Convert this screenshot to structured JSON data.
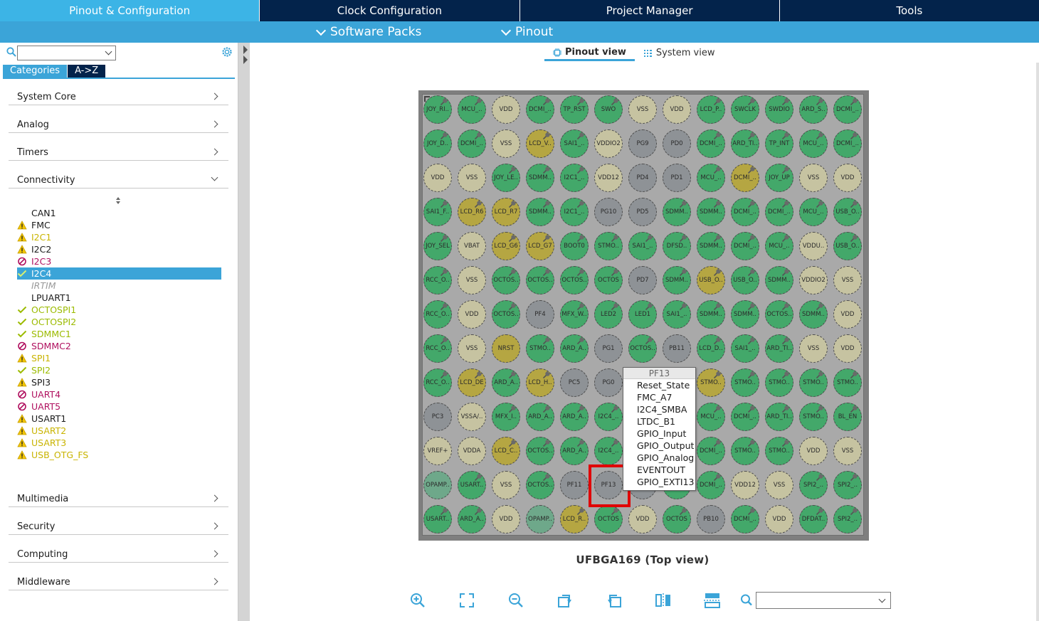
{
  "top_tabs": [
    {
      "label": "Pinout & Configuration",
      "active": true
    },
    {
      "label": "Clock Configuration",
      "active": false
    },
    {
      "label": "Project Manager",
      "active": false
    },
    {
      "label": "Tools",
      "active": false
    }
  ],
  "sub_menus": [
    "Software Packs",
    "Pinout"
  ],
  "left": {
    "search_value": "",
    "cat_tabs": [
      "Categories",
      "A->Z"
    ],
    "categories_top": [
      "System Core",
      "Analog",
      "Timers",
      "Connectivity"
    ],
    "categories_bottom": [
      "Multimedia",
      "Security",
      "Computing",
      "Middleware"
    ],
    "peripherals": [
      {
        "label": "CAN1",
        "status": "none",
        "color": "normal"
      },
      {
        "label": "FMC",
        "status": "warning",
        "color": "normal"
      },
      {
        "label": "I2C1",
        "status": "warning",
        "color": "yellow"
      },
      {
        "label": "I2C2",
        "status": "warning",
        "color": "normal"
      },
      {
        "label": "I2C3",
        "status": "blocked",
        "color": "magenta"
      },
      {
        "label": "I2C4",
        "status": "check",
        "color": "selected",
        "selected": true
      },
      {
        "label": "IRTIM",
        "status": "none",
        "color": "gray"
      },
      {
        "label": "LPUART1",
        "status": "none",
        "color": "normal"
      },
      {
        "label": "OCTOSPI1",
        "status": "check",
        "color": "green"
      },
      {
        "label": "OCTOSPI2",
        "status": "check",
        "color": "green"
      },
      {
        "label": "SDMMC1",
        "status": "check",
        "color": "green"
      },
      {
        "label": "SDMMC2",
        "status": "blocked",
        "color": "magenta"
      },
      {
        "label": "SPI1",
        "status": "warning",
        "color": "yellow"
      },
      {
        "label": "SPI2",
        "status": "check",
        "color": "green"
      },
      {
        "label": "SPI3",
        "status": "warning",
        "color": "normal"
      },
      {
        "label": "UART4",
        "status": "blocked",
        "color": "magenta"
      },
      {
        "label": "UART5",
        "status": "blocked",
        "color": "magenta"
      },
      {
        "label": "USART1",
        "status": "warning",
        "color": "normal"
      },
      {
        "label": "USART2",
        "status": "warning",
        "color": "yellow"
      },
      {
        "label": "USART3",
        "status": "warning",
        "color": "yellow"
      },
      {
        "label": "USB_OTG_FS",
        "status": "warning",
        "color": "yellow"
      }
    ]
  },
  "view_tabs": [
    "Pinout view",
    "System view"
  ],
  "package_caption": "UFBGA169 (Top view)",
  "pin_grid": [
    [
      [
        "JOY_RI..",
        "g",
        1
      ],
      [
        "MCU_..",
        "g",
        1
      ],
      [
        "VDD",
        "b",
        0
      ],
      [
        "DCMI_..",
        "g",
        1
      ],
      [
        "TP_RST",
        "g",
        1
      ],
      [
        "SWO",
        "g",
        1
      ],
      [
        "VSS",
        "b",
        0
      ],
      [
        "VDD",
        "b",
        0
      ],
      [
        "LCD_P..",
        "g",
        1
      ],
      [
        "SWCLK",
        "g",
        1
      ],
      [
        "SWDIO",
        "g",
        1
      ],
      [
        "ARD_S..",
        "g",
        1
      ],
      [
        "DCMI_..",
        "g",
        1
      ]
    ],
    [
      [
        "JOY_D..",
        "g",
        1
      ],
      [
        "DCMI_..",
        "g",
        1
      ],
      [
        "VSS",
        "b",
        0
      ],
      [
        "LCD_V..",
        "y",
        1
      ],
      [
        "SAI1_..",
        "g",
        1
      ],
      [
        "VDDIO2",
        "b",
        0
      ],
      [
        "PG9",
        "x",
        0
      ],
      [
        "PD0",
        "x",
        0
      ],
      [
        "DCMI_..",
        "g",
        1
      ],
      [
        "ARD_TI..",
        "g",
        1
      ],
      [
        "TP_INT",
        "g",
        1
      ],
      [
        "MCU_..",
        "g",
        1
      ],
      [
        "DCMI_..",
        "g",
        1
      ]
    ],
    [
      [
        "VDD",
        "b",
        0
      ],
      [
        "VSS",
        "b",
        0
      ],
      [
        "JOY_LE..",
        "g",
        1
      ],
      [
        "SDMM..",
        "g",
        1
      ],
      [
        "I2C1_..",
        "g",
        1
      ],
      [
        "VDD12",
        "b",
        0
      ],
      [
        "PD4",
        "x",
        0
      ],
      [
        "PD1",
        "x",
        0
      ],
      [
        "MCU_..",
        "g",
        1
      ],
      [
        "DCMI_..",
        "y",
        1
      ],
      [
        "JOY_UP",
        "g",
        1
      ],
      [
        "VSS",
        "b",
        0
      ],
      [
        "VDD",
        "b",
        0
      ]
    ],
    [
      [
        "SAI1_F..",
        "g",
        1
      ],
      [
        "LCD_R6",
        "y",
        1
      ],
      [
        "LCD_R7",
        "y",
        1
      ],
      [
        "SDMM..",
        "g",
        1
      ],
      [
        "I2C1_..",
        "g",
        1
      ],
      [
        "PG10",
        "x",
        0
      ],
      [
        "PD5",
        "x",
        0
      ],
      [
        "SDMM..",
        "g",
        1
      ],
      [
        "SDMM..",
        "g",
        1
      ],
      [
        "DCMI_..",
        "g",
        1
      ],
      [
        "DCMI_..",
        "g",
        1
      ],
      [
        "MCU_..",
        "g",
        1
      ],
      [
        "USB_O..",
        "g",
        1
      ]
    ],
    [
      [
        "JOY_SEL",
        "g",
        1
      ],
      [
        "VBAT",
        "b",
        0
      ],
      [
        "LCD_G6",
        "y",
        1
      ],
      [
        "LCD_G7",
        "y",
        1
      ],
      [
        "BOOT0",
        "g",
        1
      ],
      [
        "STMO..",
        "g",
        1
      ],
      [
        "SAI1_..",
        "g",
        1
      ],
      [
        "DFSD..",
        "g",
        1
      ],
      [
        "SDMM..",
        "g",
        1
      ],
      [
        "DCMI_..",
        "g",
        1
      ],
      [
        "MCU_..",
        "g",
        1
      ],
      [
        "VDDU..",
        "b",
        0
      ],
      [
        "USB_O..",
        "g",
        1
      ]
    ],
    [
      [
        "RCC_O..",
        "g",
        1
      ],
      [
        "VSS",
        "b",
        0
      ],
      [
        "OCTOS..",
        "g",
        1
      ],
      [
        "OCTOS..",
        "g",
        1
      ],
      [
        "OCTOS..",
        "g",
        1
      ],
      [
        "OCTOS",
        "g",
        1
      ],
      [
        "PD7",
        "x",
        0
      ],
      [
        "SDMM..",
        "g",
        1
      ],
      [
        "USB_O..",
        "y",
        1
      ],
      [
        "USB_O..",
        "g",
        1
      ],
      [
        "SDMM..",
        "g",
        1
      ],
      [
        "VDDIO2",
        "b",
        0
      ],
      [
        "VSS",
        "b",
        0
      ]
    ],
    [
      [
        "RCC_O..",
        "g",
        1
      ],
      [
        "VDD",
        "b",
        0
      ],
      [
        "OCTOS..",
        "g",
        1
      ],
      [
        "PF4",
        "x",
        0
      ],
      [
        "MFX_W..",
        "g",
        1
      ],
      [
        "LED2",
        "g",
        1
      ],
      [
        "LED1",
        "g",
        1
      ],
      [
        "SAI1_..",
        "g",
        1
      ],
      [
        "SDMM..",
        "g",
        1
      ],
      [
        "SDMM..",
        "g",
        1
      ],
      [
        "OCTOS..",
        "g",
        1
      ],
      [
        "SDMM..",
        "g",
        1
      ],
      [
        "VDD",
        "b",
        0
      ]
    ],
    [
      [
        "RCC_O..",
        "g",
        1
      ],
      [
        "VSS",
        "b",
        0
      ],
      [
        "NRST",
        "y",
        0
      ],
      [
        "STMO..",
        "g",
        1
      ],
      [
        "ARD_A..",
        "g",
        1
      ],
      [
        "PG1",
        "x",
        0
      ],
      [
        "OCTOS..",
        "g",
        1
      ],
      [
        "PB11",
        "x",
        0
      ],
      [
        "LCD_D..",
        "g",
        1
      ],
      [
        "SAI1_..",
        "g",
        1
      ],
      [
        "ARD_TI..",
        "g",
        1
      ],
      [
        "VSS",
        "b",
        0
      ],
      [
        "VDD",
        "b",
        0
      ]
    ],
    [
      [
        "RCC_O..",
        "g",
        1
      ],
      [
        "LCD_DE",
        "y",
        1
      ],
      [
        "ARD_A..",
        "g",
        1
      ],
      [
        "LCD_H..",
        "y",
        1
      ],
      [
        "PC5",
        "x",
        0
      ],
      [
        "PG0",
        "x",
        0
      ],
      [
        "",
        "x",
        0
      ],
      [
        "",
        "x",
        0
      ],
      [
        "STMO..",
        "y",
        1
      ],
      [
        "STMO..",
        "g",
        1
      ],
      [
        "STMO..",
        "g",
        1
      ],
      [
        "STMO..",
        "g",
        1
      ],
      [
        "STMO..",
        "g",
        1
      ]
    ],
    [
      [
        "PC3",
        "x",
        0
      ],
      [
        "VSSA/..",
        "b",
        0
      ],
      [
        "MFX_I..",
        "g",
        1
      ],
      [
        "ARD_A..",
        "g",
        1
      ],
      [
        "ARD_A..",
        "g",
        1
      ],
      [
        "I2C4_..",
        "g",
        1
      ],
      [
        "",
        "x",
        0
      ],
      [
        "",
        "x",
        0
      ],
      [
        "MCU_..",
        "g",
        1
      ],
      [
        "DCMI_..",
        "g",
        1
      ],
      [
        "ARD_TI..",
        "g",
        1
      ],
      [
        "STMO..",
        "g",
        1
      ],
      [
        "BL_EN",
        "g",
        1
      ]
    ],
    [
      [
        "VREF+",
        "b",
        0
      ],
      [
        "VDDA",
        "b",
        0
      ],
      [
        "LCD_C..",
        "y",
        1
      ],
      [
        "OCTOS..",
        "g",
        1
      ],
      [
        "ARD_A..",
        "g",
        1
      ],
      [
        "I2C4_..",
        "g",
        1
      ],
      [
        "",
        "x",
        0
      ],
      [
        "",
        "x",
        0
      ],
      [
        "DCMI_..",
        "g",
        1
      ],
      [
        "STMO..",
        "g",
        1
      ],
      [
        "STMO..",
        "g",
        1
      ],
      [
        "VDD",
        "b",
        0
      ],
      [
        "VSS",
        "b",
        0
      ]
    ],
    [
      [
        "OPAMP..",
        "t",
        0
      ],
      [
        "USART..",
        "g",
        1
      ],
      [
        "VSS",
        "b",
        0
      ],
      [
        "OCTOS..",
        "g",
        1
      ],
      [
        "PF11",
        "x",
        0
      ],
      [
        "PF13",
        "x",
        0
      ],
      [
        "",
        "x",
        0
      ],
      [
        "",
        "g",
        0
      ],
      [
        "DCMI_..",
        "g",
        1
      ],
      [
        "VDD12",
        "b",
        0
      ],
      [
        "VSS",
        "b",
        0
      ],
      [
        "SPI2_..",
        "g",
        1
      ],
      [
        "SPI2_..",
        "g",
        1
      ]
    ],
    [
      [
        "USART..",
        "g",
        1
      ],
      [
        "ARD_A..",
        "g",
        1
      ],
      [
        "VDD",
        "b",
        0
      ],
      [
        "OPAMP..",
        "t",
        0
      ],
      [
        "LCD_R..",
        "y",
        1
      ],
      [
        "OCTOS",
        "g",
        1
      ],
      [
        "VDD",
        "b",
        0
      ],
      [
        "OCTOS",
        "g",
        1
      ],
      [
        "PB10",
        "x",
        0
      ],
      [
        "DCMI_..",
        "g",
        1
      ],
      [
        "VDD",
        "b",
        0
      ],
      [
        "DFDAT..",
        "g",
        1
      ],
      [
        "SPI2_..",
        "g",
        1
      ]
    ]
  ],
  "pin_menu": {
    "title": "PF13",
    "items": [
      "Reset_State",
      "FMC_A7",
      "I2C4_SMBA",
      "LTDC_B1",
      "GPIO_Input",
      "GPIO_Output",
      "GPIO_Analog",
      "EVENTOUT",
      "GPIO_EXTI13"
    ]
  },
  "toolbar": {
    "icons": [
      "zoom-in-icon",
      "fit-screen-icon",
      "zoom-out-icon",
      "rotate-right-icon",
      "rotate-left-icon",
      "flip-horizontal-icon",
      "flip-vertical-icon"
    ],
    "zoom_value": ""
  },
  "colors": {
    "dark_navy": "#03234b",
    "accent_blue": "#3ba4d8",
    "pin_green": "#43a86a",
    "pin_yellow": "#b5a642",
    "pin_beige": "#c6c3a1",
    "pin_gray": "#8e9296",
    "highlight_red": "#e00000"
  }
}
